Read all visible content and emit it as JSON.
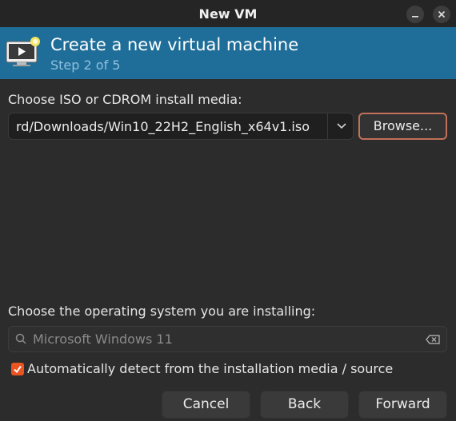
{
  "window": {
    "title": "New VM",
    "minimize_icon": "minimize-icon",
    "close_icon": "close-icon"
  },
  "header": {
    "icon": "vm-monitor-icon",
    "title": "Create a new virtual machine",
    "step": "Step 2 of 5"
  },
  "media": {
    "label": "Choose ISO or CDROM install media:",
    "path_value": "rd/Downloads/Win10_22H2_English_x64v1.iso",
    "browse_label": "Browse..."
  },
  "os": {
    "label": "Choose the operating system you are installing:",
    "search_value": "Microsoft Windows 11",
    "auto_detect_checked": true,
    "auto_detect_label": "Automatically detect from the installation media / source"
  },
  "footer": {
    "cancel_label": "Cancel",
    "back_label": "Back",
    "forward_label": "Forward"
  },
  "colors": {
    "header_bg": "#1f6e99",
    "accent": "#e95420",
    "browse_border": "#c2705a"
  }
}
